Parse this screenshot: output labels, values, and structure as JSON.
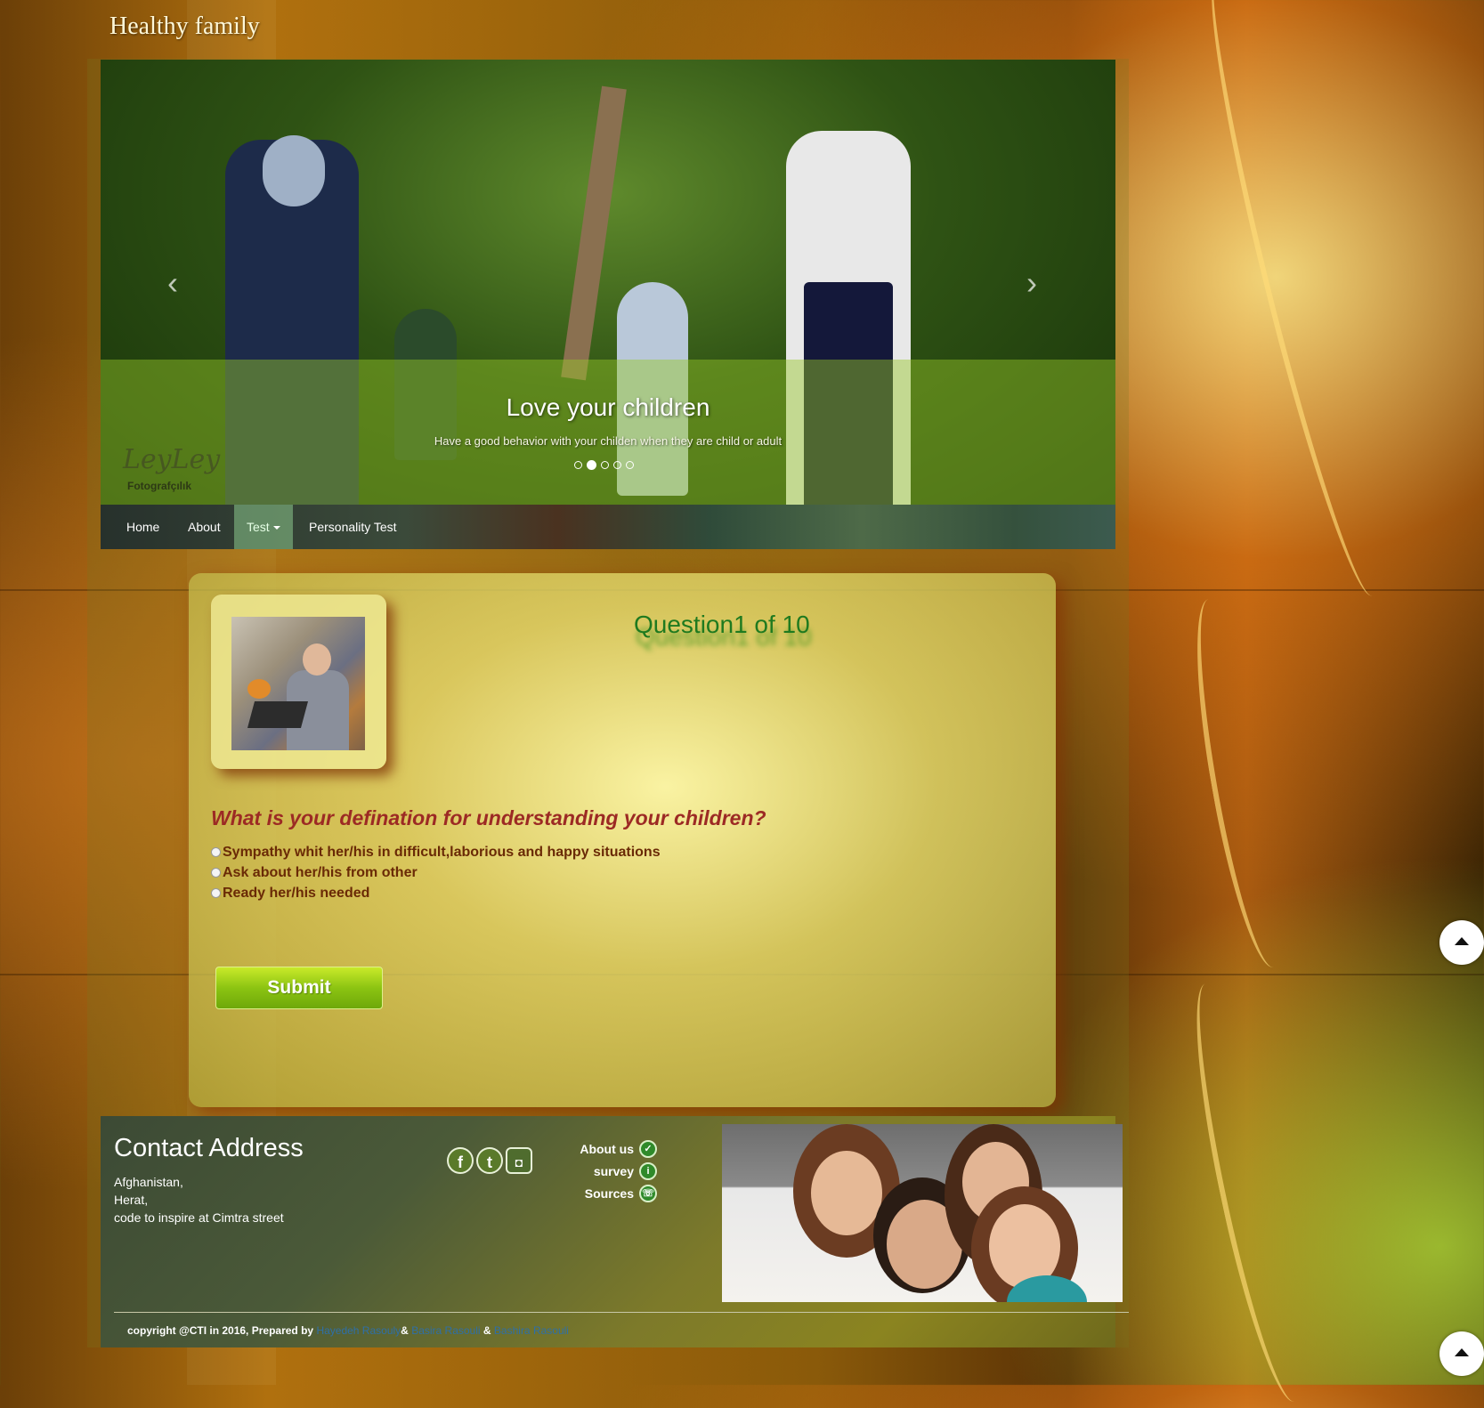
{
  "site": {
    "title": "Healthy family"
  },
  "carousel": {
    "caption_title": "Love your children",
    "caption_text": "Have a good behavior with your childen when they are child or adult",
    "prev_icon": "chevron-left-icon",
    "next_icon": "chevron-right-icon",
    "slide_count": 5,
    "active_slide": 2,
    "watermark": "LeyLey",
    "watermark_sub": "Fotografçılık"
  },
  "nav": {
    "items": [
      {
        "label": "Home"
      },
      {
        "label": "About"
      },
      {
        "label": "Test",
        "active": true,
        "dropdown": true
      },
      {
        "label": "Personality Test"
      }
    ]
  },
  "question": {
    "counter": "Question1 of 10",
    "text": "What is your defination for understanding your children?",
    "options": [
      "Sympathy whit her/his in difficult,laborious and happy situations",
      "Ask about her/his from other",
      "Ready her/his needed"
    ],
    "submit_label": "Submit"
  },
  "footer": {
    "contact_title": "Contact Address",
    "address_lines": [
      "Afghanistan,",
      "Herat,",
      "code to inspire at Cimtra street"
    ],
    "social_icons": [
      "facebook-icon",
      "twitter-icon",
      "instagram-icon"
    ],
    "links": [
      {
        "label": "About us",
        "icon": "thumbs-up-icon"
      },
      {
        "label": "survey",
        "icon": "info-icon"
      },
      {
        "label": "Sources",
        "icon": "phone-icon"
      }
    ],
    "copyright_prefix": "copyright @CTI in 2016, Prepared by ",
    "authors": [
      "Hayedeh Rasouly",
      "Basira Rasouli",
      "Bashira Rasouli"
    ],
    "separator": "&"
  },
  "colors": {
    "question_counter": "#1f7a1f",
    "question_text": "#9c2a24",
    "option_text": "#6a2a06",
    "submit": "#8cc412",
    "author_link": "#2e6fa8"
  }
}
